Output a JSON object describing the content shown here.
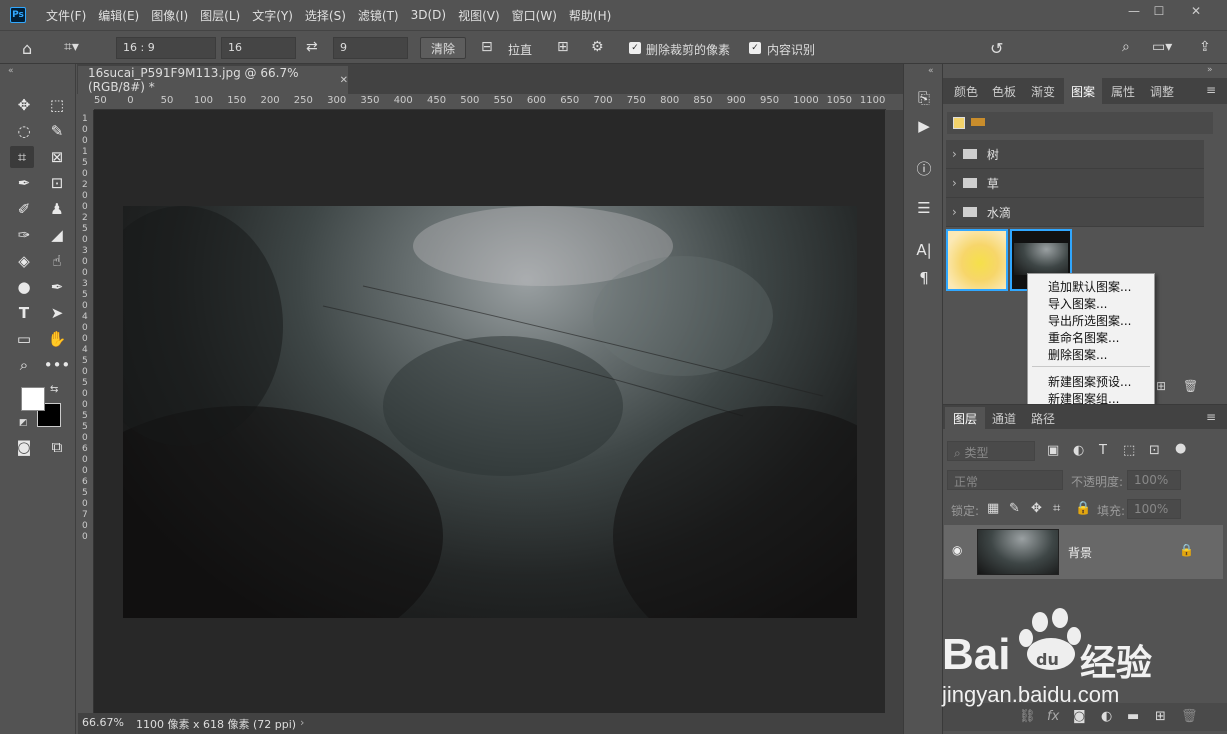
{
  "app": {
    "logo": "Ps",
    "menu": [
      "文件(F)",
      "编辑(E)",
      "图像(I)",
      "图层(L)",
      "文字(Y)",
      "选择(S)",
      "滤镜(T)",
      "3D(D)",
      "视图(V)",
      "窗口(W)",
      "帮助(H)"
    ],
    "window_controls": [
      "—",
      "☐",
      "✕"
    ]
  },
  "options_bar": {
    "ratio_preset": "16 : 9",
    "width_value": "16",
    "height_value": "9",
    "clear_label": "清除",
    "straighten_label": "拉直",
    "delete_cropped_label": "删除裁剪的像素",
    "content_aware_label": "内容识别"
  },
  "document": {
    "tab_title": "16sucai_P591F9M113.jpg @ 66.7%(RGB/8#) *",
    "zoom": "66.67%",
    "info": "1100 像素 x 618 像素 (72 ppi)",
    "ruler_h": [
      "50",
      "0",
      "50",
      "100",
      "150",
      "200",
      "250",
      "300",
      "350",
      "400",
      "450",
      "500",
      "550",
      "600",
      "650",
      "700",
      "750",
      "800",
      "850",
      "900",
      "950",
      "1000",
      "1050",
      "1100"
    ],
    "ruler_v": [
      "1",
      "0",
      "0",
      "1",
      "5",
      "0",
      "2",
      "0",
      "0",
      "2",
      "5",
      "0",
      "3",
      "0",
      "0",
      "3",
      "5",
      "0",
      "4",
      "0",
      "0",
      "4",
      "5",
      "0",
      "5",
      "0",
      "0",
      "5",
      "5",
      "0",
      "6",
      "0",
      "0",
      "6",
      "5",
      "0",
      "7",
      "0",
      "0"
    ]
  },
  "panel_top": {
    "tabs": [
      "颜色",
      "色板",
      "渐变",
      "图案",
      "属性",
      "调整"
    ],
    "active_tab": "图案",
    "groups": [
      "树",
      "草",
      "水滴"
    ]
  },
  "context_menu": {
    "items": [
      "追加默认图案...",
      "导入图案...",
      "导出所选图案...",
      "重命名图案...",
      "删除图案...",
      "新建图案预设...",
      "新建图案组..."
    ]
  },
  "layers_panel": {
    "tabs": [
      "图层",
      "通道",
      "路径"
    ],
    "filter_label": "类型",
    "blend_mode": "正常",
    "opacity_label": "不透明度:",
    "opacity_value": "100%",
    "lock_label": "锁定:",
    "fill_label": "填充:",
    "fill_value": "100%",
    "layer_name": "背景"
  },
  "watermark": {
    "brand": "Bai",
    "brand2": "du",
    "cn": "经验",
    "url": "jingyan.baidu.com"
  }
}
